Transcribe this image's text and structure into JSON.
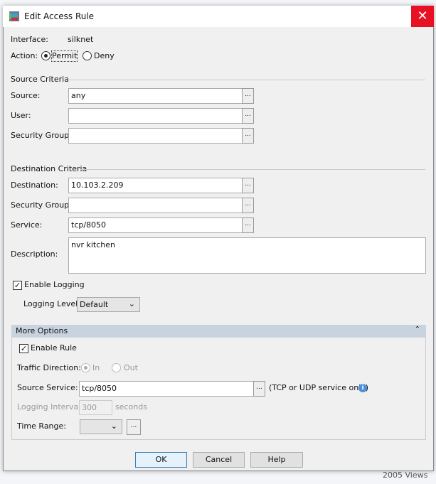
{
  "background": {
    "views_text": "2005 Views"
  },
  "window": {
    "title": "Edit Access Rule",
    "close": "✕"
  },
  "interface": {
    "label": "Interface:",
    "value": "silknet"
  },
  "action": {
    "label": "Action:",
    "options": [
      "Permit",
      "Deny"
    ],
    "selected": "Permit"
  },
  "source_criteria": {
    "heading": "Source Criteria",
    "source_label": "Source:",
    "source_value": "any",
    "user_label": "User:",
    "user_value": "",
    "sg_label": "Security Group:",
    "sg_value": ""
  },
  "destination_criteria": {
    "heading": "Destination Criteria",
    "dest_label": "Destination:",
    "dest_value": "10.103.2.209",
    "sg_label": "Security Group:",
    "sg_value": "",
    "service_label": "Service:",
    "service_value": "tcp/8050"
  },
  "description": {
    "label": "Description:",
    "value": "nvr kitchen"
  },
  "logging": {
    "enable_label": "Enable Logging",
    "enabled": true,
    "level_label": "Logging Level:",
    "level_value": "Default"
  },
  "more_options": {
    "heading": "More Options",
    "enable_rule_label": "Enable Rule",
    "enable_rule": true,
    "traffic_label": "Traffic Direction:",
    "traffic_options": [
      "In",
      "Out"
    ],
    "traffic_selected": "In",
    "source_service_label": "Source Service:",
    "source_service_value": "tcp/8050",
    "source_service_note": "(TCP or UDP service only)",
    "interval_label": "Logging Interval:",
    "interval_value": "300",
    "interval_unit": "seconds",
    "time_range_label": "Time Range:",
    "time_range_value": ""
  },
  "browse": "...",
  "buttons": {
    "ok": "OK",
    "cancel": "Cancel",
    "help": "Help"
  },
  "colors": {
    "close": "#e81123",
    "panel_header": "#c8d3df",
    "info": "#4a90d9"
  }
}
